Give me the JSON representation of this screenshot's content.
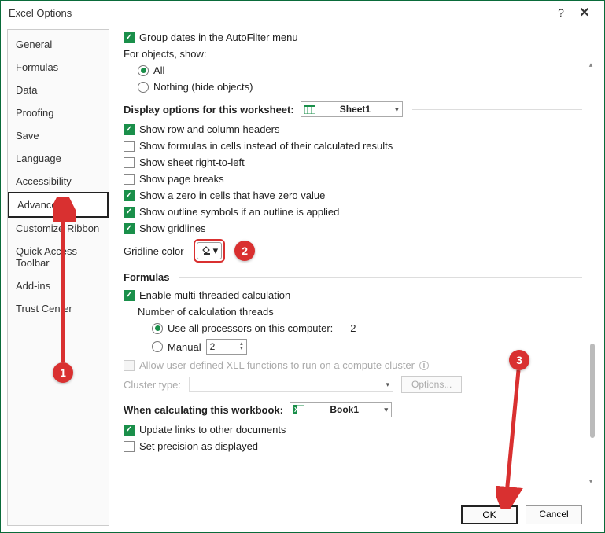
{
  "title": "Excel Options",
  "sidebar": {
    "items": [
      {
        "label": "General"
      },
      {
        "label": "Formulas"
      },
      {
        "label": "Data"
      },
      {
        "label": "Proofing"
      },
      {
        "label": "Save"
      },
      {
        "label": "Language"
      },
      {
        "label": "Accessibility"
      },
      {
        "label": "Advanced",
        "selected": true
      },
      {
        "label": "Customize Ribbon"
      },
      {
        "label": "Quick Access Toolbar"
      },
      {
        "label": "Add-ins"
      },
      {
        "label": "Trust Center"
      }
    ]
  },
  "content": {
    "group_dates": "Group dates in the AutoFilter menu",
    "for_objects": "For objects, show:",
    "obj_all": "All",
    "obj_nothing": "Nothing (hide objects)",
    "disp_worksheet_head": "Display options for this worksheet:",
    "disp_worksheet_value": "Sheet1",
    "show_headers": "Show row and column headers",
    "show_formulas": "Show formulas in cells instead of their calculated results",
    "show_rtl": "Show sheet right-to-left",
    "show_breaks": "Show page breaks",
    "show_zero": "Show a zero in cells that have zero value",
    "show_outline": "Show outline symbols if an outline is applied",
    "show_gridlines": "Show gridlines",
    "gridline_color": "Gridline color",
    "formulas_head": "Formulas",
    "enable_mt": "Enable multi-threaded calculation",
    "num_threads": "Number of calculation threads",
    "use_all": "Use all processors on this computer:",
    "proc_count": "2",
    "manual": "Manual",
    "manual_value": "2",
    "allow_xll": "Allow user-defined XLL functions to run on a compute cluster",
    "cluster_type": "Cluster type:",
    "options_btn": "Options...",
    "calc_workbook_head": "When calculating this workbook:",
    "calc_workbook_value": "Book1",
    "update_links": "Update links to other documents",
    "set_precision": "Set precision as displayed"
  },
  "footer": {
    "ok": "OK",
    "cancel": "Cancel"
  },
  "callouts": {
    "c1": "1",
    "c2": "2",
    "c3": "3"
  }
}
